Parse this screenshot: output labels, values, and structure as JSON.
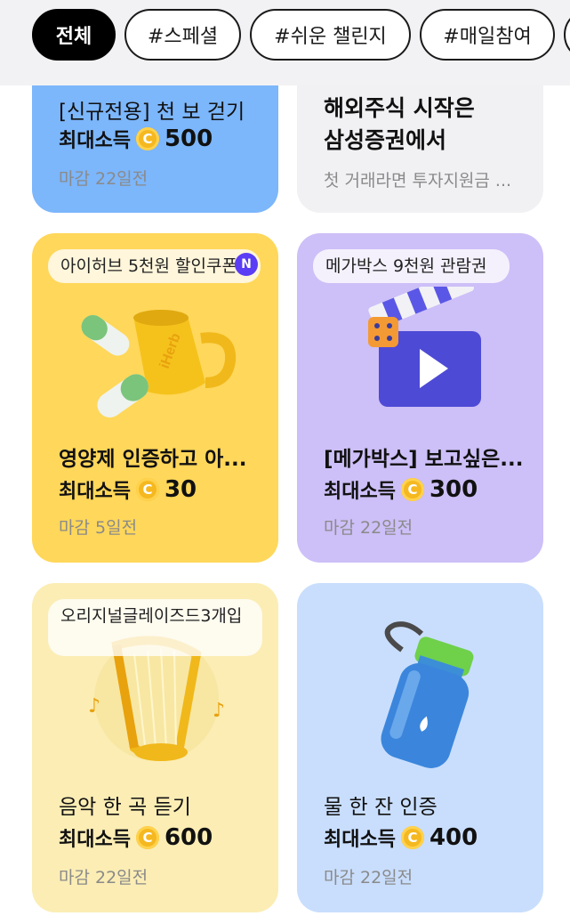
{
  "tabs": [
    {
      "label": "전체",
      "active": true
    },
    {
      "label": "#스페셜",
      "active": false
    },
    {
      "label": "#쉬운 챌린지",
      "active": false
    },
    {
      "label": "#매일참여",
      "active": false
    }
  ],
  "coin_symbol": "C",
  "cards": [
    {
      "title": "[신규전용] 천 보 걷기",
      "reward_label": "최대소득",
      "reward_amount": "500",
      "deadline": "마감 22일전",
      "bg": "#7cb6fb"
    },
    {
      "title_line1": "해외주식 시작은",
      "title_line2": "삼성증권에서",
      "subtitle": "첫 거래라면 투자지원금 ...",
      "bg": "#f1f1f4"
    },
    {
      "badge": "아이허브 5천원 할인쿠폰",
      "new_badge": "N",
      "product_text": "iHerb",
      "title": "영양제 인증하고 아...",
      "reward_label": "최대소득",
      "reward_amount": "30",
      "deadline": "마감 5일전",
      "icon": "supplement-cup-icon",
      "bg": "#ffd75a"
    },
    {
      "badge": "메가박스 9천원 관람권",
      "title": "[메가박스] 보고싶은...",
      "reward_label": "최대소득",
      "reward_amount": "300",
      "deadline": "마감 22일전",
      "icon": "clapperboard-icon",
      "bg": "#cdbff7"
    },
    {
      "badge": "오리지널글레이즈드3개입",
      "title": "음악 한 곡 듣기",
      "reward_label": "최대소득",
      "reward_amount": "600",
      "deadline": "마감 22일전",
      "icon": "harp-icon",
      "bg": "#fbedb4"
    },
    {
      "title": "물 한 잔 인증",
      "reward_label": "최대소득",
      "reward_amount": "400",
      "deadline": "마감 22일전",
      "icon": "water-bottle-icon",
      "bg": "#c9defd"
    }
  ]
}
